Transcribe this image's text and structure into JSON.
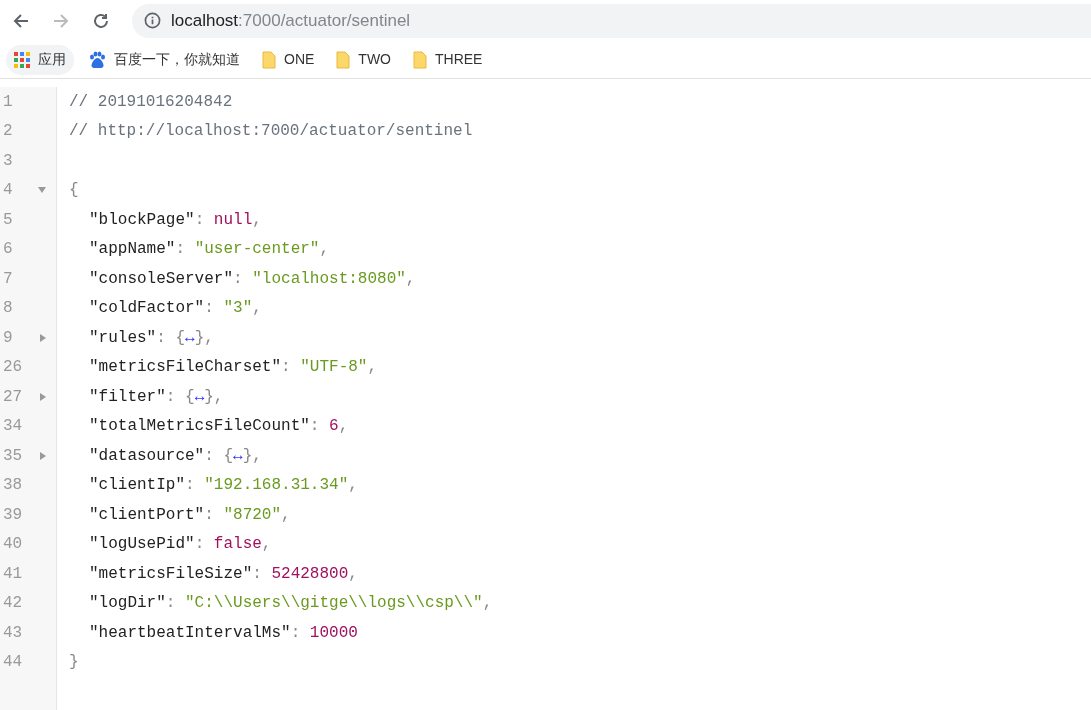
{
  "toolbar": {
    "back_disabled": false,
    "forward_disabled": true,
    "url": {
      "host": "localhost",
      "path": ":7000/actuator/sentinel"
    }
  },
  "bookmarks": [
    {
      "kind": "apps",
      "label": "应用"
    },
    {
      "kind": "site",
      "label": "百度一下，你就知道"
    },
    {
      "kind": "folder",
      "label": "ONE"
    },
    {
      "kind": "folder",
      "label": "TWO"
    },
    {
      "kind": "folder",
      "label": "THREE"
    }
  ],
  "lines": [
    {
      "number": "1",
      "tokens": [
        {
          "kind": "comment",
          "text": "// 20191016204842"
        }
      ]
    },
    {
      "number": "2",
      "tokens": [
        {
          "kind": "comment",
          "text": "// http://localhost:7000/actuator/sentinel"
        }
      ]
    },
    {
      "number": "3"
    },
    {
      "number": "4",
      "expanded": true,
      "tokens": [
        {
          "kind": "punct",
          "text": "{"
        }
      ]
    },
    {
      "number": "5",
      "indent": true,
      "tokens": [
        {
          "kind": "key",
          "text": "\"blockPage\""
        },
        {
          "kind": "punct",
          "text": ": "
        },
        {
          "kind": "literal",
          "text": "null"
        },
        {
          "kind": "punct",
          "text": ","
        }
      ]
    },
    {
      "number": "6",
      "indent": true,
      "tokens": [
        {
          "kind": "key",
          "text": "\"appName\""
        },
        {
          "kind": "punct",
          "text": ": "
        },
        {
          "kind": "string",
          "text": "\"user-center\""
        },
        {
          "kind": "punct",
          "text": ","
        }
      ]
    },
    {
      "number": "7",
      "indent": true,
      "tokens": [
        {
          "kind": "key",
          "text": "\"consoleServer\""
        },
        {
          "kind": "punct",
          "text": ": "
        },
        {
          "kind": "string",
          "text": "\"localhost:8080\""
        },
        {
          "kind": "punct",
          "text": ","
        }
      ]
    },
    {
      "number": "8",
      "indent": true,
      "tokens": [
        {
          "kind": "key",
          "text": "\"coldFactor\""
        },
        {
          "kind": "punct",
          "text": ": "
        },
        {
          "kind": "string",
          "text": "\"3\""
        },
        {
          "kind": "punct",
          "text": ","
        }
      ]
    },
    {
      "number": "9",
      "expanded": false,
      "indent": true,
      "tokens": [
        {
          "kind": "key",
          "text": "\"rules\""
        },
        {
          "kind": "punct",
          "text": ": "
        },
        {
          "kind": "punct",
          "text": "{"
        },
        {
          "kind": "ellipsis",
          "text": "↔"
        },
        {
          "kind": "punct",
          "text": "},"
        }
      ]
    },
    {
      "number": "26",
      "indent": true,
      "tokens": [
        {
          "kind": "key",
          "text": "\"metricsFileCharset\""
        },
        {
          "kind": "punct",
          "text": ": "
        },
        {
          "kind": "string",
          "text": "\"UTF-8\""
        },
        {
          "kind": "punct",
          "text": ","
        }
      ]
    },
    {
      "number": "27",
      "expanded": false,
      "indent": true,
      "tokens": [
        {
          "kind": "key",
          "text": "\"filter\""
        },
        {
          "kind": "punct",
          "text": ": "
        },
        {
          "kind": "punct",
          "text": "{"
        },
        {
          "kind": "ellipsis",
          "text": "↔"
        },
        {
          "kind": "punct",
          "text": "},"
        }
      ]
    },
    {
      "number": "34",
      "indent": true,
      "tokens": [
        {
          "kind": "key",
          "text": "\"totalMetricsFileCount\""
        },
        {
          "kind": "punct",
          "text": ": "
        },
        {
          "kind": "literal",
          "text": "6"
        },
        {
          "kind": "punct",
          "text": ","
        }
      ]
    },
    {
      "number": "35",
      "expanded": false,
      "indent": true,
      "tokens": [
        {
          "kind": "key",
          "text": "\"datasource\""
        },
        {
          "kind": "punct",
          "text": ": "
        },
        {
          "kind": "punct",
          "text": "{"
        },
        {
          "kind": "ellipsis",
          "text": "↔"
        },
        {
          "kind": "punct",
          "text": "},"
        }
      ]
    },
    {
      "number": "38",
      "indent": true,
      "tokens": [
        {
          "kind": "key",
          "text": "\"clientIp\""
        },
        {
          "kind": "punct",
          "text": ": "
        },
        {
          "kind": "string",
          "text": "\"192.168.31.34\""
        },
        {
          "kind": "punct",
          "text": ","
        }
      ]
    },
    {
      "number": "39",
      "indent": true,
      "tokens": [
        {
          "kind": "key",
          "text": "\"clientPort\""
        },
        {
          "kind": "punct",
          "text": ": "
        },
        {
          "kind": "string",
          "text": "\"8720\""
        },
        {
          "kind": "punct",
          "text": ","
        }
      ]
    },
    {
      "number": "40",
      "indent": true,
      "tokens": [
        {
          "kind": "key",
          "text": "\"logUsePid\""
        },
        {
          "kind": "punct",
          "text": ": "
        },
        {
          "kind": "literal",
          "text": "false"
        },
        {
          "kind": "punct",
          "text": ","
        }
      ]
    },
    {
      "number": "41",
      "indent": true,
      "tokens": [
        {
          "kind": "key",
          "text": "\"metricsFileSize\""
        },
        {
          "kind": "punct",
          "text": ": "
        },
        {
          "kind": "literal",
          "text": "52428800"
        },
        {
          "kind": "punct",
          "text": ","
        }
      ]
    },
    {
      "number": "42",
      "indent": true,
      "tokens": [
        {
          "kind": "key",
          "text": "\"logDir\""
        },
        {
          "kind": "punct",
          "text": ": "
        },
        {
          "kind": "string",
          "text": "\"C:\\\\Users\\\\gitge\\\\logs\\\\csp\\\\\""
        },
        {
          "kind": "punct",
          "text": ","
        }
      ]
    },
    {
      "number": "43",
      "indent": true,
      "tokens": [
        {
          "kind": "key",
          "text": "\"heartbeatIntervalMs\""
        },
        {
          "kind": "punct",
          "text": ": "
        },
        {
          "kind": "literal",
          "text": "10000"
        }
      ]
    },
    {
      "number": "44",
      "tokens": [
        {
          "kind": "punct",
          "text": "}"
        }
      ]
    }
  ]
}
